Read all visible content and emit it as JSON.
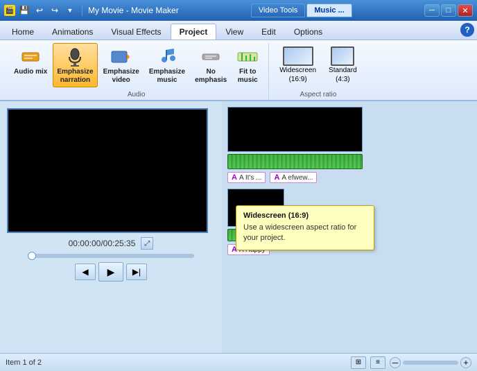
{
  "titlebar": {
    "title": "My Movie - Movie Maker",
    "qat_buttons": [
      "💾",
      "↩",
      "↪"
    ],
    "tab_video_tools": "Video Tools",
    "tab_music": "Music ...",
    "win_minimize": "─",
    "win_maximize": "□",
    "win_close": "✕"
  },
  "ribbon_tabs": {
    "tabs": [
      "Home",
      "Animations",
      "Visual Effects",
      "Project",
      "View",
      "Edit",
      "Options"
    ],
    "active": "Project",
    "help": "?"
  },
  "ribbon": {
    "audio_group_label": "Audio",
    "aspect_group_label": "Aspect ratio",
    "buttons": {
      "audio_mix": "Audio mix",
      "emphasize_narration": "Emphasize narration",
      "emphasize_video": "Emphasize video",
      "emphasize_music": "Emphasize music",
      "no_emphasis": "No emphasis",
      "fit_to_music": "Fit to music",
      "widescreen": "Widescreen (16:9)",
      "standard": "Standard (4:3)"
    }
  },
  "preview": {
    "time": "00:00:00/00:25:35",
    "expand_icon": "⤢"
  },
  "controls": {
    "prev": "◀",
    "play": "▶",
    "next": "▶|"
  },
  "storyboard": {
    "clips": [
      {
        "labels": [
          "A It's ...",
          "A efwew..."
        ]
      },
      {
        "labels": [
          "A Happy"
        ]
      }
    ]
  },
  "tooltip": {
    "title": "Widescreen (16:9)",
    "text": "Use a widescreen aspect ratio for your project."
  },
  "statusbar": {
    "item_count": "Item 1 of 2",
    "zoom_minus": "─",
    "zoom_plus": "+"
  }
}
